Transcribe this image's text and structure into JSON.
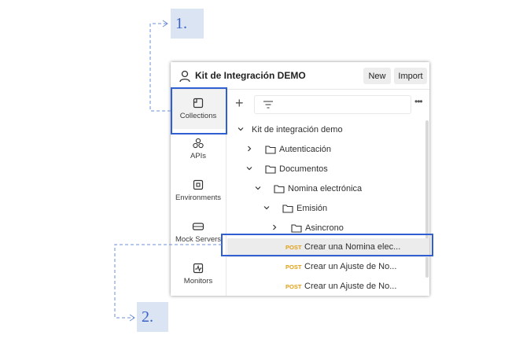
{
  "callouts": {
    "one": "1.",
    "two": "2."
  },
  "header": {
    "workspace_title": "Kit de Integración DEMO",
    "new_label": "New",
    "import_label": "Import"
  },
  "sidebar": {
    "items": [
      {
        "label": "Collections",
        "icon": "collections-icon",
        "active": true
      },
      {
        "label": "APIs",
        "icon": "apis-icon"
      },
      {
        "label": "Environments",
        "icon": "environments-icon"
      },
      {
        "label": "Mock Servers",
        "icon": "mock-servers-icon"
      },
      {
        "label": "Monitors",
        "icon": "monitors-icon"
      }
    ]
  },
  "tree": {
    "collection": "Kit de integración demo",
    "folders": [
      "Autenticación",
      "Documentos",
      "Nomina electrónica",
      "Emisión",
      "Asincrono"
    ],
    "requests": [
      {
        "method": "POST",
        "name": "Crear una Nomina elec..."
      },
      {
        "method": "POST",
        "name": "Crear un Ajuste de No..."
      },
      {
        "method": "POST",
        "name": "Crear un Ajuste de No..."
      }
    ]
  },
  "colors": {
    "highlight": "#2f5fd0",
    "method_post": "#e0a017"
  }
}
